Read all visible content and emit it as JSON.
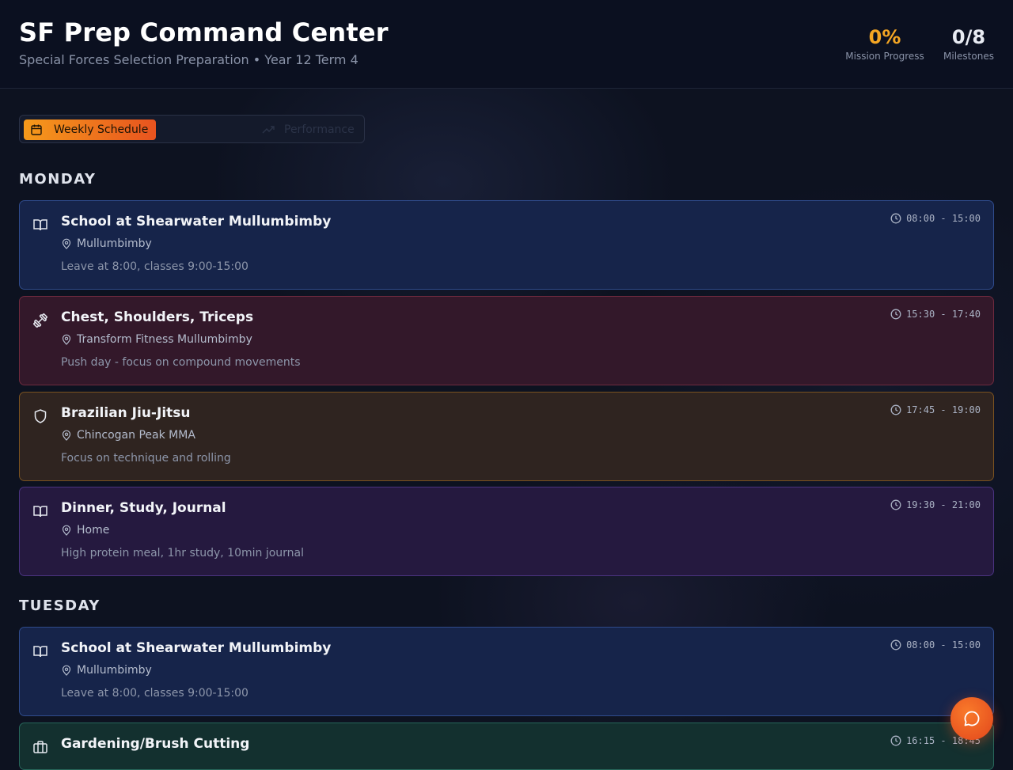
{
  "header": {
    "title": "SF Prep Command Center",
    "subtitle": "Special Forces Selection Preparation • Year 12 Term 4",
    "stats": {
      "progress_value": "0%",
      "progress_label": "Mission Progress",
      "milestones_value": "0/8",
      "milestones_label": "Milestones"
    }
  },
  "tabs": {
    "schedule": "Weekly Schedule",
    "performance": "Performance"
  },
  "days": [
    {
      "name": "MONDAY",
      "events": [
        {
          "icon": "book-icon",
          "title": "School at Shearwater Mullumbimby",
          "location": "Mullumbimby",
          "note": "Leave at 8:00, classes 9:00-15:00",
          "time": "08:00 - 15:00",
          "color": "blue"
        },
        {
          "icon": "dumbbell-icon",
          "title": "Chest, Shoulders, Triceps",
          "location": "Transform Fitness Mullumbimby",
          "note": "Push day - focus on compound movements",
          "time": "15:30 - 17:40",
          "color": "red"
        },
        {
          "icon": "shield-icon",
          "title": "Brazilian Jiu-Jitsu",
          "location": "Chincogan Peak MMA",
          "note": "Focus on technique and rolling",
          "time": "17:45 - 19:00",
          "color": "amber"
        },
        {
          "icon": "book-icon",
          "title": "Dinner, Study, Journal",
          "location": "Home",
          "note": "High protein meal, 1hr study, 10min journal",
          "time": "19:30 - 21:00",
          "color": "purple"
        }
      ]
    },
    {
      "name": "TUESDAY",
      "events": [
        {
          "icon": "book-icon",
          "title": "School at Shearwater Mullumbimby",
          "location": "Mullumbimby",
          "note": "Leave at 8:00, classes 9:00-15:00",
          "time": "08:00 - 15:00",
          "color": "blue"
        },
        {
          "icon": "briefcase-icon",
          "title": "Gardening/Brush Cutting",
          "location": "",
          "note": "",
          "time": "16:15 - 18:45",
          "color": "green"
        }
      ]
    }
  ],
  "colors": {
    "accent": "#f5a623",
    "tab_gradient_start": "#f59a1b",
    "tab_gradient_end": "#e8531f",
    "school": "#2f4b8c",
    "gym": "#6e2a3e",
    "martial_arts": "#7a5220",
    "evening": "#4a3380",
    "work": "#27665a"
  },
  "fab": {
    "icon": "chat-icon"
  }
}
